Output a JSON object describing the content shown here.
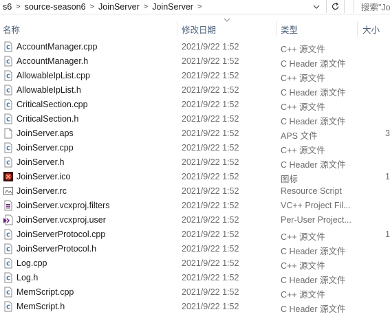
{
  "address": {
    "crumbs": [
      "s6",
      "source-season6",
      "JoinServer",
      "JoinServer"
    ]
  },
  "search": {
    "placeholder": "搜索\"Jo"
  },
  "columns": {
    "name": "名称",
    "date": "修改日期",
    "type": "类型",
    "size": "大小"
  },
  "files": [
    {
      "name": "AccountManager.cpp",
      "date": "2021/9/22 1:52",
      "type": "C++ 源文件",
      "size": "",
      "icon": "cpp-file-icon"
    },
    {
      "name": "AccountManager.h",
      "date": "2021/9/22 1:52",
      "type": "C Header 源文件",
      "size": "",
      "icon": "header-file-icon"
    },
    {
      "name": "AllowableIpList.cpp",
      "date": "2021/9/22 1:52",
      "type": "C++ 源文件",
      "size": "",
      "icon": "cpp-file-icon"
    },
    {
      "name": "AllowableIpList.h",
      "date": "2021/9/22 1:52",
      "type": "C Header 源文件",
      "size": "",
      "icon": "header-file-icon"
    },
    {
      "name": "CriticalSection.cpp",
      "date": "2021/9/22 1:52",
      "type": "C++ 源文件",
      "size": "",
      "icon": "cpp-file-icon"
    },
    {
      "name": "CriticalSection.h",
      "date": "2021/9/22 1:52",
      "type": "C Header 源文件",
      "size": "",
      "icon": "header-file-icon"
    },
    {
      "name": "JoinServer.aps",
      "date": "2021/9/22 1:52",
      "type": "APS 文件",
      "size": "3",
      "icon": "blank-file-icon"
    },
    {
      "name": "JoinServer.cpp",
      "date": "2021/9/22 1:52",
      "type": "C++ 源文件",
      "size": "",
      "icon": "cpp-file-icon"
    },
    {
      "name": "JoinServer.h",
      "date": "2021/9/22 1:52",
      "type": "C Header 源文件",
      "size": "",
      "icon": "header-file-icon"
    },
    {
      "name": "JoinServer.ico",
      "date": "2021/9/22 1:52",
      "type": "图标",
      "size": "1",
      "icon": "ico-file-icon"
    },
    {
      "name": "JoinServer.rc",
      "date": "2021/9/22 1:52",
      "type": "Resource Script",
      "size": "",
      "icon": "resource-script-icon"
    },
    {
      "name": "JoinServer.vcxproj.filters",
      "date": "2021/9/22 1:52",
      "type": "VC++ Project Fil...",
      "size": "",
      "icon": "vcxproj-filters-icon"
    },
    {
      "name": "JoinServer.vcxproj.user",
      "date": "2021/9/22 1:52",
      "type": "Per-User Project...",
      "size": "",
      "icon": "vcxproj-user-icon"
    },
    {
      "name": "JoinServerProtocol.cpp",
      "date": "2021/9/22 1:52",
      "type": "C++ 源文件",
      "size": "1",
      "icon": "cpp-file-icon"
    },
    {
      "name": "JoinServerProtocol.h",
      "date": "2021/9/22 1:52",
      "type": "C Header 源文件",
      "size": "",
      "icon": "header-file-icon"
    },
    {
      "name": "Log.cpp",
      "date": "2021/9/22 1:52",
      "type": "C++ 源文件",
      "size": "",
      "icon": "cpp-file-icon"
    },
    {
      "name": "Log.h",
      "date": "2021/9/22 1:52",
      "type": "C Header 源文件",
      "size": "",
      "icon": "header-file-icon"
    },
    {
      "name": "MemScript.cpp",
      "date": "2021/9/22 1:52",
      "type": "C++ 源文件",
      "size": "",
      "icon": "cpp-file-icon"
    },
    {
      "name": "MemScript.h",
      "date": "2021/9/22 1:52",
      "type": "C Header 源文件",
      "size": "",
      "icon": "header-file-icon"
    }
  ]
}
